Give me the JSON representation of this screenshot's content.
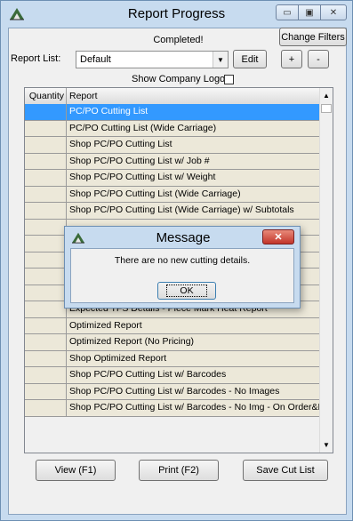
{
  "window": {
    "title": "Report Progress",
    "controls": {
      "minimize": "▭",
      "maximize": "▣",
      "close": "✕"
    }
  },
  "status": "Completed!",
  "buttons": {
    "change_filters": "Change Filters",
    "edit": "Edit",
    "add": "+",
    "remove": "-",
    "view": "View (F1)",
    "print": "Print (F2)",
    "save_cut_list": "Save Cut List"
  },
  "report_list": {
    "label": "Report List:",
    "selected": "Default"
  },
  "show_company_logo": {
    "label": "Show Company Logo:",
    "checked": false
  },
  "grid": {
    "columns": [
      "Quantity",
      "Report"
    ],
    "rows": [
      {
        "quantity": "",
        "report": "PC/PO Cutting List",
        "selected": true
      },
      {
        "quantity": "",
        "report": "PC/PO Cutting List (Wide Carriage)"
      },
      {
        "quantity": "",
        "report": "Shop PC/PO Cutting List"
      },
      {
        "quantity": "",
        "report": "Shop PC/PO Cutting List w/ Job #"
      },
      {
        "quantity": "",
        "report": "Shop PC/PO Cutting List w/ Weight"
      },
      {
        "quantity": "",
        "report": "Shop PC/PO Cutting List (Wide Carriage)"
      },
      {
        "quantity": "",
        "report": "Shop PC/PO Cutting List (Wide Carriage) w/ Subtotals"
      },
      {
        "quantity": "",
        "report": ""
      },
      {
        "quantity": "",
        "report": ""
      },
      {
        "quantity": "",
        "report": ""
      },
      {
        "quantity": "",
        "report": ""
      },
      {
        "quantity": "",
        "report": ""
      },
      {
        "quantity": "",
        "report": "Expected TFS Details - Piece Mark Heat Report"
      },
      {
        "quantity": "",
        "report": "Optimized Report"
      },
      {
        "quantity": "",
        "report": "Optimized Report (No Pricing)"
      },
      {
        "quantity": "",
        "report": "Shop Optimized Report"
      },
      {
        "quantity": "",
        "report": "Shop PC/PO Cutting List w/ Barcodes"
      },
      {
        "quantity": "",
        "report": "Shop PC/PO Cutting List w/ Barcodes - No Images"
      },
      {
        "quantity": "",
        "report": "Shop PC/PO Cutting List w/ Barcodes - No Img - On Order&Req"
      }
    ]
  },
  "dialog": {
    "title": "Message",
    "message": "There are no new cutting details.",
    "ok": "OK",
    "close": "✕"
  },
  "icons": {
    "app": "app-logo-icon",
    "dropdown": "▼",
    "scroll_up": "▲",
    "scroll_down": "▼"
  }
}
